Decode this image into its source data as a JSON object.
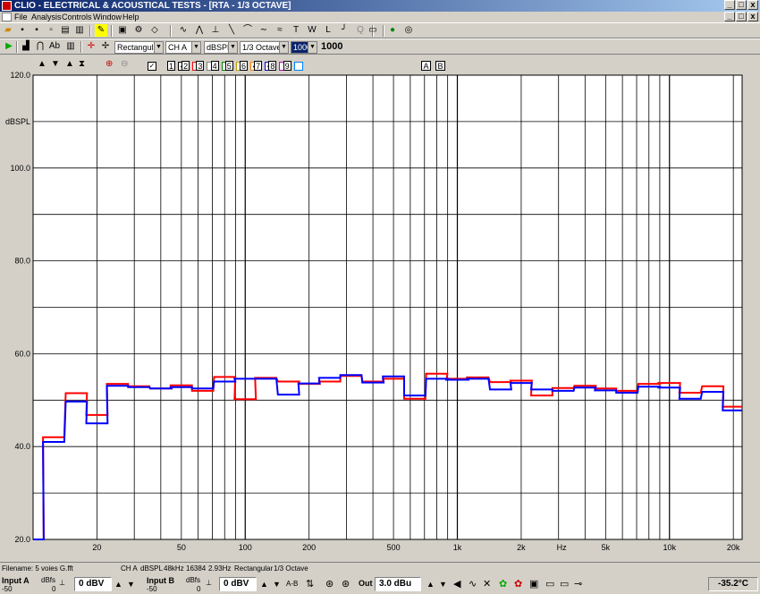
{
  "window": {
    "title": "CLIO - ELECTRICAL & ACOUSTICAL TESTS - [RTA - 1/3 OCTAVE]",
    "minimize": "_",
    "maximize": "□",
    "close": "x"
  },
  "menu": {
    "items": [
      {
        "label": "File",
        "x": 16
      },
      {
        "label": "Analysis",
        "x": 35
      },
      {
        "label": "Controls",
        "x": 69
      },
      {
        "label": "Window",
        "x": 104
      },
      {
        "label": "Help",
        "x": 137
      }
    ]
  },
  "toolbar2": {
    "window_combo": "Rectangular",
    "channel_combo": "CH A",
    "unit_combo": "dBSPL",
    "band_combo": "1/3 Octave",
    "avg_combo": "1000",
    "avg_value": "1000"
  },
  "graph_toolbar": {
    "checkbox_labels": [
      "1",
      "2",
      "3",
      "4",
      "5",
      "6",
      "7",
      "8",
      "9"
    ],
    "checkbox_colors": [
      "#000000",
      "#ff0000",
      "#808080",
      "#008000",
      "#c0a000",
      "#ff8000",
      "#0000ff",
      "#c000c0",
      "#0080ff"
    ],
    "checked": [
      true,
      true,
      false,
      false,
      false,
      false,
      true,
      true,
      false,
      false
    ],
    "a_label": "A",
    "b_label": "B"
  },
  "chart_data": {
    "type": "line",
    "ylabel": "dBSPL",
    "xlabel": "Hz",
    "ylim": [
      20,
      120
    ],
    "xlim": [
      10,
      22000
    ],
    "xscale": "log",
    "yticks": [
      "120.0",
      "100.0",
      "80.0",
      "60.0",
      "40.0",
      "20.0"
    ],
    "yticks_values": [
      120,
      100,
      80,
      60,
      40,
      20
    ],
    "xticks": [
      "20",
      "50",
      "100",
      "200",
      "500",
      "1k",
      "2k",
      "Hz",
      "5k",
      "10k",
      "20k"
    ],
    "xticks_values": [
      20,
      50,
      100,
      200,
      500,
      1000,
      2000,
      3100,
      5000,
      10000,
      20000
    ],
    "bands": [
      10,
      12.5,
      16,
      20,
      25,
      31.5,
      40,
      50,
      63,
      80,
      100,
      125,
      160,
      200,
      250,
      315,
      400,
      500,
      630,
      800,
      1000,
      1250,
      1600,
      2000,
      2500,
      3150,
      4000,
      5000,
      6300,
      8000,
      10000,
      12500,
      16000,
      20000
    ],
    "series": [
      {
        "color": "#ff0000",
        "values": [
          20,
          42,
          51.5,
          46.8,
          53.5,
          53,
          52.5,
          53.2,
          52,
          55,
          50.2,
          54.8,
          54,
          53.5,
          54,
          55.2,
          54,
          54.6,
          50.3,
          55.7,
          54.6,
          54.9,
          53.9,
          54.2,
          51,
          52.6,
          53.1,
          52.5,
          52,
          53.5,
          53.7,
          51.6,
          53,
          48.6
        ]
      },
      {
        "color": "#0000ff",
        "values": [
          20,
          41,
          49.7,
          45,
          53.1,
          52.8,
          52.5,
          52.8,
          52.5,
          54,
          54.6,
          54.6,
          51.2,
          53.6,
          54.8,
          55.4,
          53.8,
          55.1,
          51,
          54.6,
          54.4,
          54.6,
          52.3,
          53.7,
          52.3,
          52,
          52.7,
          52.1,
          51.6,
          52.9,
          52.7,
          50.3,
          51.8,
          47.8
        ]
      }
    ]
  },
  "status": {
    "filename": "Filename: 5 voies G.fft",
    "channel": "CH A",
    "unit": "dBSPL",
    "rate": "48kHz",
    "points": "16384",
    "resolution": "2.93Hz",
    "window": "Rectangular",
    "bands": "1/3 Octave"
  },
  "bottom": {
    "input_a": "Input A",
    "input_a_range": "-50",
    "input_a_dbfs": "dBfs",
    "input_a_zero": "0",
    "input_a_value": "0 dBV",
    "input_b": "Input B",
    "input_b_range": "-50",
    "input_b_dbfs": "dBfs",
    "input_b_zero": "0",
    "input_b_value": "0 dBV",
    "ab_label": "A-B",
    "out_label": "Out",
    "out_value": "3.0 dBu",
    "temperature": "-35.2°C"
  }
}
